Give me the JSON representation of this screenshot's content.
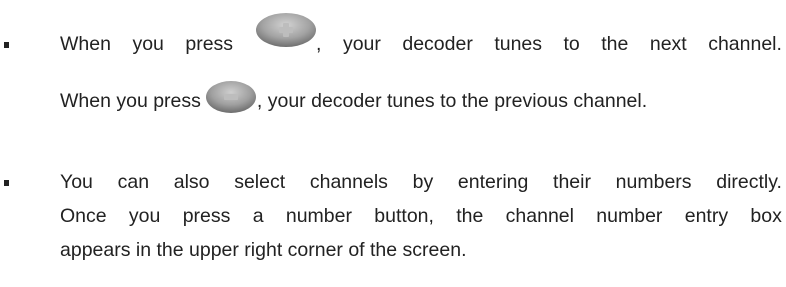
{
  "bullets": [
    {
      "lines": [
        {
          "pre_words": [
            "When",
            "you",
            "press"
          ],
          "button": "plus-button",
          "post_words": [
            ",",
            "your",
            "decoder",
            "tunes",
            "to",
            "the",
            "next",
            "channel."
          ]
        },
        {
          "pre": "When you press",
          "button": "minus-button",
          "post": ", your decoder tunes to the previous channel."
        }
      ]
    },
    {
      "lines": [
        {
          "words": [
            "You",
            "can",
            "also",
            "select",
            "channels",
            "by",
            "entering",
            "their",
            "numbers",
            "directly."
          ]
        },
        {
          "words": [
            "Once",
            "you",
            "press",
            "a",
            "number",
            "button,",
            "the",
            "channel",
            "number",
            "entry",
            "box"
          ]
        },
        {
          "text": "appears in the upper right corner of the screen."
        }
      ]
    }
  ],
  "icons": {
    "plus_button": "channel-up-plus-icon",
    "minus_button": "channel-down-minus-icon"
  },
  "colors": {
    "text": "#222222",
    "button_gray": "#9a9a9a"
  }
}
